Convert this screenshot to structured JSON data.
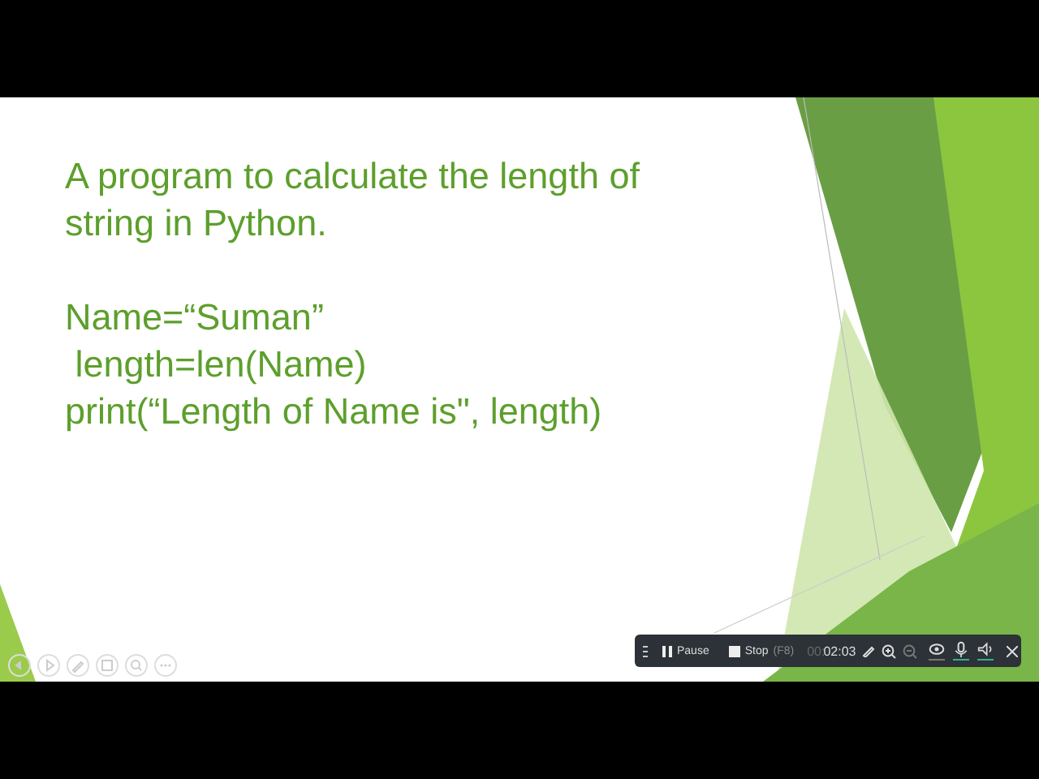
{
  "slide": {
    "title_lines": [
      "A program to calculate the length of",
      "string in Python."
    ],
    "code_lines": [
      "Name=“Suman”",
      " length=len(Name)",
      "print(“Length of Name is\", length)"
    ]
  },
  "slideshow_controls": [
    {
      "kind": "previous"
    },
    {
      "kind": "next"
    },
    {
      "kind": "pen"
    },
    {
      "kind": "slides"
    },
    {
      "kind": "zoom"
    },
    {
      "kind": "more"
    }
  ],
  "recorder_toolbar": {
    "pause_label": "Pause",
    "stop_label": "Stop",
    "stop_shortcut": "(F8)",
    "timer_prefix": "00:",
    "timer": "02:03",
    "toggles": [
      {
        "kind": "webcam",
        "on": false
      },
      {
        "kind": "microphone",
        "on": true
      },
      {
        "kind": "speaker",
        "on": true
      }
    ]
  }
}
